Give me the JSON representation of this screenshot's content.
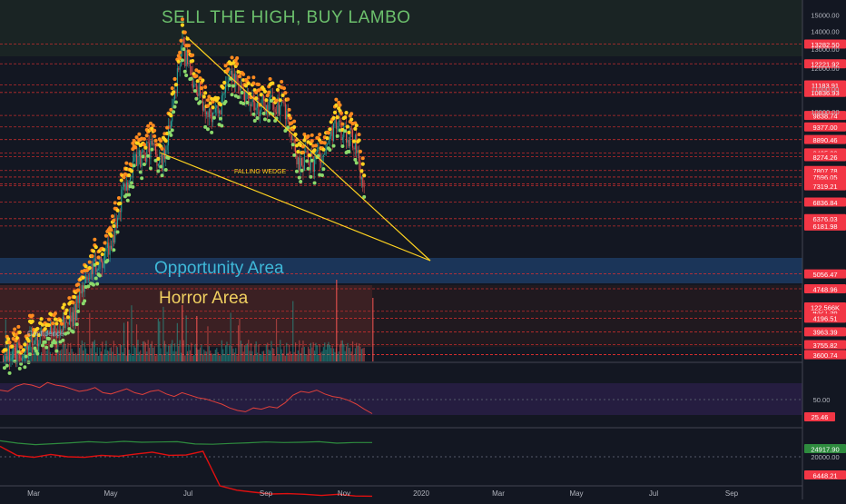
{
  "colors": {
    "background": "#131722",
    "resistance_line": "#e03030",
    "price_label_bg": "#f23645",
    "candle_up": "#26a69a",
    "candle_down": "#ef5350",
    "dot_yellow": "#ffd21f",
    "dot_orange": "#ff8a1f",
    "dot_green": "#8bd86b",
    "wedge_line": "#ffd21f",
    "opportunity_band": "#1d3b63",
    "horror_band": "#5a2a2a",
    "rsi_line": "#e0403a",
    "rsi_band": "#2a1f48",
    "cci_green": "#2e8b3e",
    "cci_red": "#e01010",
    "axis_text": "#b2b5be"
  },
  "annotations": {
    "headline": "SELL THE HIGH, BUY LAMBO",
    "opportunity": "Opportunity Area",
    "horror": "Horror Area",
    "wedge": "FALLING WEDGE",
    "bottom_left": "Confidence"
  },
  "chart_data": [
    {
      "type": "line",
      "panel": "price",
      "yscale": "log",
      "ylim": [
        3500,
        15500
      ],
      "x_ticks": [
        "Mar",
        "May",
        "Jul",
        "Sep",
        "Nov",
        "2020",
        "Mar",
        "May",
        "Jul",
        "Sep"
      ],
      "y_ticks": [
        15000,
        14000,
        13000,
        12000,
        11000,
        10000
      ],
      "price_labels": [
        "13282.50",
        "12221.92",
        "11183.91",
        "10836.93",
        "9838.74",
        "9377.00",
        "8890.46",
        "8405.20",
        "8274.26",
        "7807.78",
        "7596.05",
        "7380.68",
        "7319.21",
        "6836.84",
        "6376.03",
        "6181.98",
        "5056.47",
        "4748.96",
        "4321.98",
        "4196.51",
        "3963.39",
        "3755.82",
        "3602.54",
        "3600.74"
      ],
      "volume_label": "122.566K",
      "series": [
        {
          "x": [
            "Feb 5",
            "Mar 1",
            "Mar 15",
            "Apr 1",
            "Apr 15",
            "May 1",
            "May 10",
            "May 20",
            "Jun 1",
            "Jun 10",
            "Jun 20",
            "Jun 26",
            "Jul 5",
            "Jul 15",
            "Jul 25",
            "Aug 5",
            "Aug 15",
            "Aug 25",
            "Sep 5",
            "Sep 15",
            "Sep 25",
            "Oct 5",
            "Oct 15",
            "Oct 25",
            "Nov 1",
            "Nov 10",
            "Nov 18"
          ],
          "values": [
            3500,
            3800,
            4000,
            4200,
            5200,
            5600,
            7000,
            8000,
            8600,
            8000,
            10500,
            13200,
            11500,
            10000,
            9800,
            11800,
            10500,
            10200,
            10400,
            10000,
            8200,
            8100,
            8200,
            9300,
            9200,
            8800,
            6900
          ]
        }
      ]
    },
    {
      "type": "line",
      "panel": "rsi",
      "y_ticks": [
        50
      ],
      "last_value_label": "25.46",
      "series": [
        {
          "values": [
            62,
            60,
            68,
            72,
            70,
            66,
            74,
            70,
            68,
            64,
            60,
            62,
            66,
            58,
            56,
            60,
            64,
            58,
            55,
            60,
            62,
            56,
            52,
            58,
            54,
            50,
            48,
            44,
            40,
            34,
            30,
            28,
            34,
            32,
            36,
            34,
            42,
            54,
            60,
            58,
            62,
            56,
            52,
            50,
            46,
            40,
            32,
            25
          ]
        }
      ]
    },
    {
      "type": "line",
      "panel": "lower",
      "y_ticks": [
        20000
      ],
      "value_labels": [
        "24917.90",
        "6448.21"
      ],
      "series": [
        {
          "values": [
            25500,
            24700,
            24200,
            24500,
            24800,
            25200,
            24900,
            25300,
            25000,
            25100,
            25200,
            24400,
            24300,
            24600,
            24800,
            25100,
            24900,
            25000,
            25200,
            24700,
            24900,
            24917.9
          ]
        },
        {
          "values": [
            23600,
            20500,
            19800,
            20800,
            20000,
            19800,
            20500,
            20200,
            20900,
            21600,
            20500,
            20600,
            21900,
            10000,
            8500,
            7800,
            7200,
            7300,
            7100,
            6700,
            7100,
            6500,
            6448.21
          ]
        }
      ]
    }
  ]
}
